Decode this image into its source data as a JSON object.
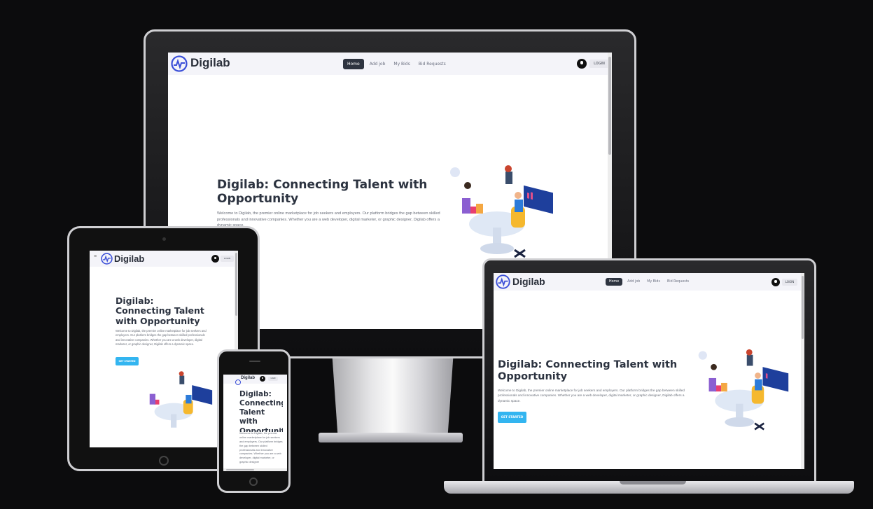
{
  "site": {
    "brand": "Digilab",
    "nav": [
      "Home",
      "Add job",
      "My Bids",
      "Bid Requests"
    ],
    "login": "LOGIN",
    "hamburger": "≡",
    "headline": "Digilab: Connecting Talent with Opportunity",
    "desc_desktop": "Welcome to Digilab, the premier online marketplace for job seekers and employers. Our platform bridges the gap between skilled professionals and innovative companies. Whether you are a web developer, digital marketer, or graphic designer, Digilab offers a dynamic space.",
    "desc_tablet": "Welcome to Digilab, the premier online marketplace for job seekers and employers. Our platform bridges the gap between skilled professionals and innovative companies. Whether you are a web developer, digital marketer, or graphic designer, Digilab offers a dynamic space.",
    "desc_phone": "Welcome to Digilab, the premier online marketplace for job seekers and employers. Our platform bridges the gap between skilled professionals and innovative companies. Whether you are a web developer, digital marketer, or graphic designer",
    "cta": "GET STARTED"
  },
  "colors": {
    "background": "#0c0c0d",
    "nav_bg": "#f4f4f9",
    "active_nav": "#2e3440",
    "cta": "#33b5f0",
    "headline": "#2c3340",
    "logo_blue": "#3b4fd8"
  }
}
